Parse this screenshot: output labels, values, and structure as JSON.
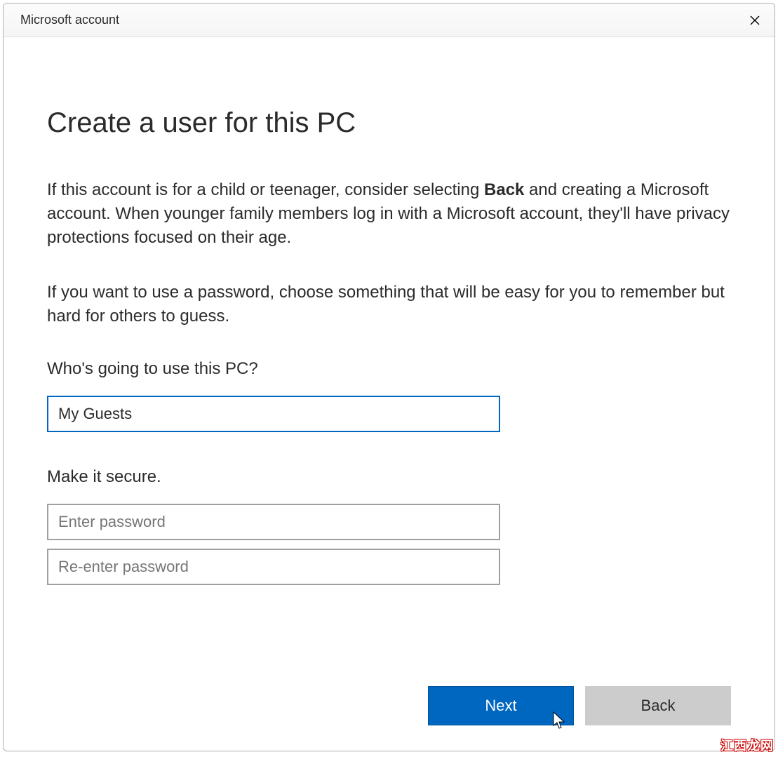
{
  "titlebar": {
    "title": "Microsoft account"
  },
  "main": {
    "heading": "Create a user for this PC",
    "paragraph1_prefix": "If this account is for a child or teenager, consider selecting ",
    "paragraph1_bold": "Back",
    "paragraph1_suffix": " and creating a Microsoft account. When younger family members log in with a Microsoft account, they'll have privacy protections focused on their age.",
    "paragraph2": "If you want to use a password, choose something that will be easy for you to remember but hard for others to guess.",
    "username_label": "Who's going to use this PC?",
    "username_value": "My Guests",
    "password_section_label": "Make it secure.",
    "password_placeholder": "Enter password",
    "password_value": "",
    "password_confirm_placeholder": "Re-enter password",
    "password_confirm_value": ""
  },
  "buttons": {
    "next": "Next",
    "back": "Back"
  },
  "watermark": "江西龙网"
}
